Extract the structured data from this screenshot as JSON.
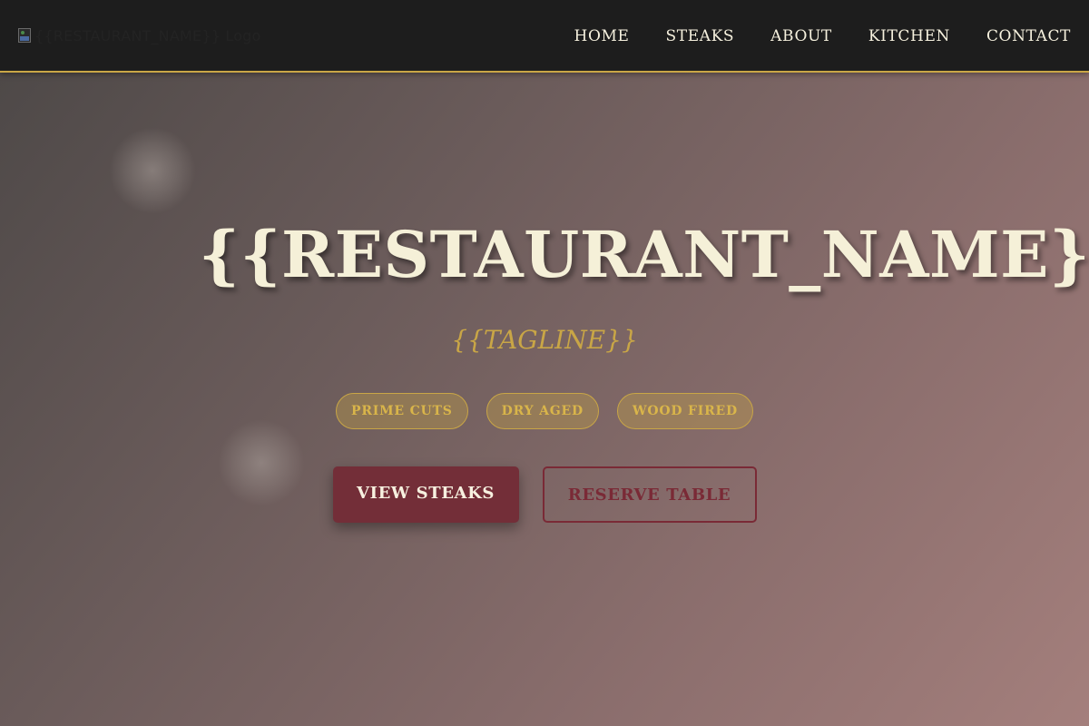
{
  "header": {
    "logo_alt": "{{RESTAURANT_NAME}} Logo",
    "nav": [
      {
        "label": "HOME"
      },
      {
        "label": "STEAKS"
      },
      {
        "label": "ABOUT"
      },
      {
        "label": "KITCHEN"
      },
      {
        "label": "CONTACT"
      }
    ]
  },
  "hero": {
    "title": "{{RESTAURANT_NAME}}",
    "tagline": "{{TAGLINE}}",
    "badges": [
      {
        "label": "PRIME CUTS"
      },
      {
        "label": "DRY AGED"
      },
      {
        "label": "WOOD FIRED"
      }
    ],
    "primary_button": "VIEW STEAKS",
    "secondary_button": "RESERVE TABLE"
  },
  "colors": {
    "header_bg": "#1d1d1d",
    "accent_gold": "#c9a646",
    "burgundy": "#732e38",
    "cream": "#f5f0d8"
  }
}
